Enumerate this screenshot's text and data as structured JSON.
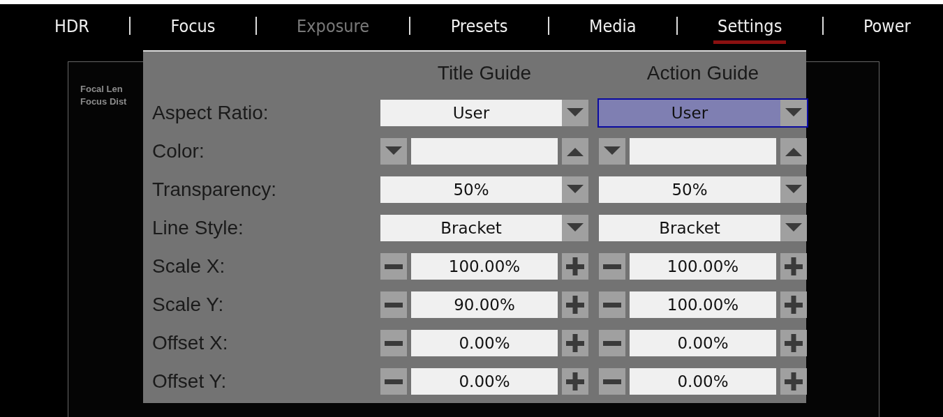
{
  "tabs": [
    {
      "label": "HDR",
      "selected": false,
      "disabled": false
    },
    {
      "label": "Focus",
      "selected": false,
      "disabled": false
    },
    {
      "label": "Exposure",
      "selected": false,
      "disabled": true
    },
    {
      "label": "Presets",
      "selected": false,
      "disabled": false
    },
    {
      "label": "Media",
      "selected": false,
      "disabled": false
    },
    {
      "label": "Settings",
      "selected": true,
      "disabled": false
    },
    {
      "label": "Power",
      "selected": false,
      "disabled": false
    }
  ],
  "background_panel": {
    "lines": [
      "Focal Len",
      "Focus Dist"
    ]
  },
  "dialog": {
    "columns": [
      "Title Guide",
      "Action Guide"
    ],
    "rows": [
      {
        "label": "Aspect Ratio:",
        "kind": "dropdown",
        "cells": [
          {
            "value": "User",
            "focused": false
          },
          {
            "value": "User",
            "focused": true
          }
        ]
      },
      {
        "label": "Color:",
        "kind": "color",
        "cells": [
          {
            "focused": false
          },
          {
            "focused": false
          }
        ]
      },
      {
        "label": "Transparency:",
        "kind": "dropdown",
        "cells": [
          {
            "value": "50%",
            "focused": false
          },
          {
            "value": "50%",
            "focused": false
          }
        ]
      },
      {
        "label": "Line Style:",
        "kind": "dropdown",
        "cells": [
          {
            "value": "Bracket",
            "focused": false
          },
          {
            "value": "Bracket",
            "focused": false
          }
        ]
      },
      {
        "label": "Scale X:",
        "kind": "stepper",
        "cells": [
          {
            "value": "100.00%",
            "focused": false
          },
          {
            "value": "100.00%",
            "focused": false
          }
        ]
      },
      {
        "label": "Scale Y:",
        "kind": "stepper",
        "cells": [
          {
            "value": "90.00%",
            "focused": false
          },
          {
            "value": "100.00%",
            "focused": false
          }
        ]
      },
      {
        "label": "Offset X:",
        "kind": "stepper",
        "cells": [
          {
            "value": "0.00%",
            "focused": false
          },
          {
            "value": "0.00%",
            "focused": false
          }
        ]
      },
      {
        "label": "Offset Y:",
        "kind": "stepper",
        "cells": [
          {
            "value": "0.00%",
            "focused": false
          },
          {
            "value": "0.00%",
            "focused": false
          }
        ]
      }
    ]
  }
}
